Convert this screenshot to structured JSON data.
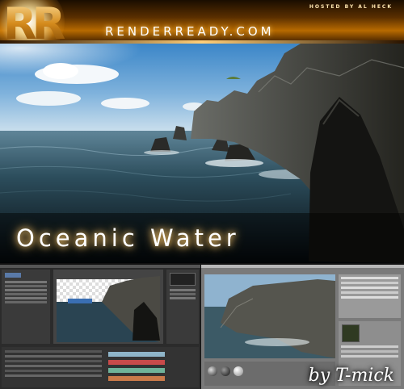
{
  "header": {
    "logo_letters": "RR",
    "hosted_by": "HOSTED BY AL HECK",
    "site": "RENDERREADY.COM"
  },
  "hero": {
    "title": "Oceanic Water"
  },
  "footer": {
    "credit": "by T-mick"
  },
  "colors": {
    "banner_orange": "#b76a00",
    "sky_top": "#3b86c8",
    "sea": "#1d3b48",
    "title_glow": "#ffd27a"
  }
}
